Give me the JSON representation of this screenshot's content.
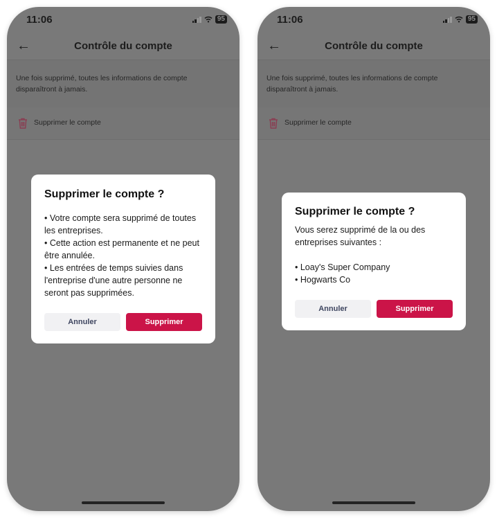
{
  "colors": {
    "accent": "#cb1448",
    "overlay_background": "#797979",
    "dialog_background": "#ffffff",
    "cancel_button_bg": "#f1f1f3",
    "cancel_button_text": "#3f4660"
  },
  "screens": [
    {
      "status_bar": {
        "time": "11:06",
        "battery": "95"
      },
      "header": {
        "back_icon": "arrow-left-icon",
        "title": "Contrôle du compte"
      },
      "info_text": "Une fois supprimé, toutes les informations de compte disparaîtront à jamais.",
      "delete_row": {
        "icon": "trash-icon",
        "label": "Supprimer le compte"
      },
      "dialog": {
        "title": "Supprimer le compte ?",
        "bullets": [
          "• Votre compte sera supprimé de toutes les entreprises.",
          "• Cette action est permanente et ne peut être annulée.",
          "• Les entrées de temps suivies dans l'entreprise d'une autre personne ne seront pas supprimées."
        ],
        "cancel_label": "Annuler",
        "confirm_label": "Supprimer"
      }
    },
    {
      "status_bar": {
        "time": "11:06",
        "battery": "95"
      },
      "header": {
        "back_icon": "arrow-left-icon",
        "title": "Contrôle du compte"
      },
      "info_text": "Une fois supprimé, toutes les informations de compte disparaîtront à jamais.",
      "delete_row": {
        "icon": "trash-icon",
        "label": "Supprimer le compte"
      },
      "dialog": {
        "title": "Supprimer le compte ?",
        "message": "Vous serez supprimé de la ou des entreprises suivantes :",
        "companies": [
          "• Loay's Super Company",
          "• Hogwarts Co"
        ],
        "cancel_label": "Annuler",
        "confirm_label": "Supprimer"
      }
    }
  ]
}
